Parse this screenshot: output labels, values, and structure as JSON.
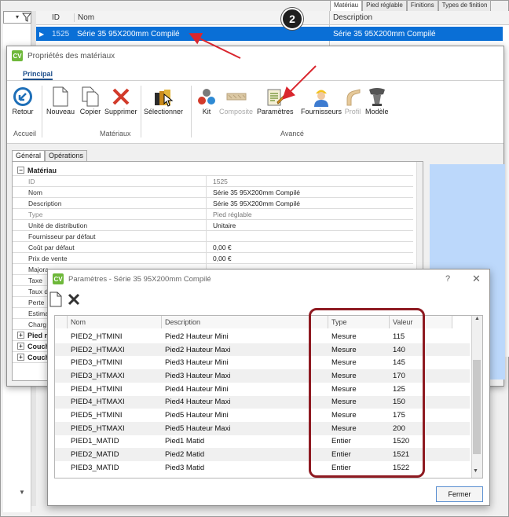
{
  "background": {
    "columns": {
      "id": "ID",
      "name": "Nom",
      "description": "Description"
    },
    "selected_row": {
      "id": "1525",
      "name": "Série 35 95X200mm Compilé",
      "description": "Série 35 95X200mm Compilé"
    },
    "tabs": [
      "Matériau",
      "Pied réglable",
      "Finitions",
      "Types de finition"
    ],
    "callout_number": "2"
  },
  "props_window": {
    "logo": "CV",
    "title": "Propriétés des matériaux",
    "ribbon_tab": "Principal",
    "buttons": {
      "retour": "Retour",
      "nouveau": "Nouveau",
      "copier": "Copier",
      "supprimer": "Supprimer",
      "selectionner": "Sélectionner",
      "kit": "Kit",
      "composite": "Composite",
      "parametres": "Paramètres",
      "fournisseurs": "Fournisseurs",
      "profil": "Profil",
      "modele": "Modèle"
    },
    "groups": {
      "accueil": "Accueil",
      "materiaux": "Matériaux",
      "avance": "Avancé"
    },
    "tabs": {
      "general": "Général",
      "operations": "Opérations"
    },
    "grid": {
      "category": "Matériau",
      "rows": [
        {
          "name": "ID",
          "value": "1525"
        },
        {
          "name": "Nom",
          "value": "Série 35 95X200mm Compilé"
        },
        {
          "name": "Description",
          "value": "Série 35 95X200mm Compilé"
        },
        {
          "name": "Type",
          "value": "Pied réglable"
        },
        {
          "name": "Unité de distribution",
          "value": "Unitaire"
        },
        {
          "name": "Fournisseur par défaut",
          "value": ""
        },
        {
          "name": "Coût par défaut",
          "value": "0,00 €"
        },
        {
          "name": "Prix de vente",
          "value": "0,00 €"
        },
        {
          "name": "Majora",
          "value": ""
        },
        {
          "name": "Taxe",
          "value": ""
        },
        {
          "name": "Taux d",
          "value": ""
        },
        {
          "name": "Perte",
          "value": ""
        },
        {
          "name": "Estima",
          "value": ""
        },
        {
          "name": "Charg",
          "value": ""
        }
      ],
      "collapsed": [
        "Pied r",
        "Couch",
        "Couch"
      ]
    }
  },
  "params_dialog": {
    "logo": "CV",
    "title": "Paramètres - Série 35 95X200mm Compilé",
    "help": "?",
    "close": "✕",
    "columns": {
      "name": "Nom",
      "description": "Description",
      "type": "Type",
      "value": "Valeur"
    },
    "rows": [
      {
        "name": "PIED2_HTMINI",
        "description": "Pied2 Hauteur Mini",
        "type": "Mesure",
        "value": "115"
      },
      {
        "name": "PIED2_HTMAXI",
        "description": "Pied2 Hauteur Maxi",
        "type": "Mesure",
        "value": "140"
      },
      {
        "name": "PIED3_HTMINI",
        "description": "Pied3 Hauteur Mini",
        "type": "Mesure",
        "value": "145"
      },
      {
        "name": "PIED3_HTMAXI",
        "description": "Pied3 Hauteur Maxi",
        "type": "Mesure",
        "value": "170"
      },
      {
        "name": "PIED4_HTMINI",
        "description": "Pied4 Hauteur Mini",
        "type": "Mesure",
        "value": "125"
      },
      {
        "name": "PIED4_HTMAXI",
        "description": "Pied4 Hauteur Maxi",
        "type": "Mesure",
        "value": "150"
      },
      {
        "name": "PIED5_HTMINI",
        "description": "Pied5 Hauteur Mini",
        "type": "Mesure",
        "value": "175"
      },
      {
        "name": "PIED5_HTMAXI",
        "description": "Pied5 Hauteur Maxi",
        "type": "Mesure",
        "value": "200"
      },
      {
        "name": "PIED1_MATID",
        "description": "Pied1 Matid",
        "type": "Entier",
        "value": "1520"
      },
      {
        "name": "PIED2_MATID",
        "description": "Pied2 Matid",
        "type": "Entier",
        "value": "1521"
      },
      {
        "name": "PIED3_MATID",
        "description": "Pied3 Matid",
        "type": "Entier",
        "value": "1522"
      }
    ],
    "close_button": "Fermer"
  },
  "colors": {
    "selection": "#0a6fd6",
    "highlight": "#8e1a21",
    "arrow": "#d9262e",
    "logo": "#6eb83a"
  }
}
